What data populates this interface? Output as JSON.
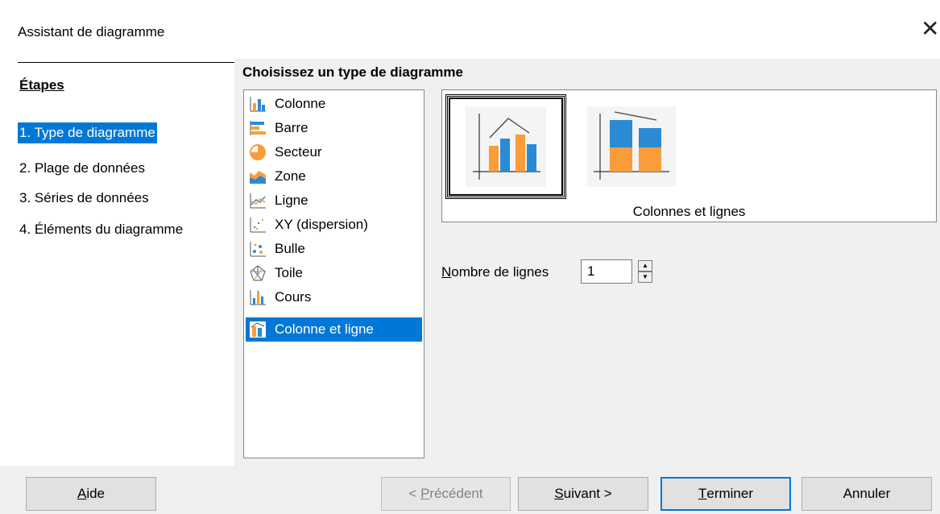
{
  "window": {
    "title": "Assistant de diagramme",
    "close_glyph": "✕"
  },
  "steps": {
    "header": "Étapes",
    "items": [
      {
        "label": "1. Type de diagramme",
        "active": true
      },
      {
        "label": "2. Plage de données",
        "active": false
      },
      {
        "label": "3. Séries de données",
        "active": false
      },
      {
        "label": "4. Éléments du diagramme",
        "active": false
      }
    ]
  },
  "main": {
    "section_title": "Choisissez un type de diagramme",
    "chart_types": [
      {
        "label": "Colonne",
        "icon": "column-chart-icon"
      },
      {
        "label": "Barre",
        "icon": "bar-chart-icon"
      },
      {
        "label": "Secteur",
        "icon": "pie-chart-icon"
      },
      {
        "label": "Zone",
        "icon": "area-chart-icon"
      },
      {
        "label": "Ligne",
        "icon": "line-chart-icon"
      },
      {
        "label": "XY (dispersion)",
        "icon": "scatter-chart-icon"
      },
      {
        "label": "Bulle",
        "icon": "bubble-chart-icon"
      },
      {
        "label": "Toile",
        "icon": "net-chart-icon"
      },
      {
        "label": "Cours",
        "icon": "stock-chart-icon"
      },
      {
        "label": "Colonne et ligne",
        "icon": "column-line-chart-icon",
        "selected": true
      }
    ],
    "variant_caption": "Colonnes et lignes",
    "variants": [
      {
        "name": "columns-and-lines",
        "selected": true
      },
      {
        "name": "stacked-columns-and-lines",
        "selected": false
      }
    ],
    "lines_label_mnemonic": "N",
    "lines_label_rest": "ombre de lignes",
    "lines_value": "1"
  },
  "buttons": {
    "help_mnemonic": "A",
    "help_rest": "ide",
    "prev_prefix": "< ",
    "prev_mnemonic": "P",
    "prev_rest": "récédent",
    "next_mnemonic": "S",
    "next_rest": "uivant >",
    "finish_mnemonic": "T",
    "finish_rest": "erminer",
    "cancel": "Annuler"
  },
  "colors": {
    "accent": "#0078d7",
    "chart_blue": "#2a8ad4",
    "chart_orange": "#fb9c3a"
  }
}
